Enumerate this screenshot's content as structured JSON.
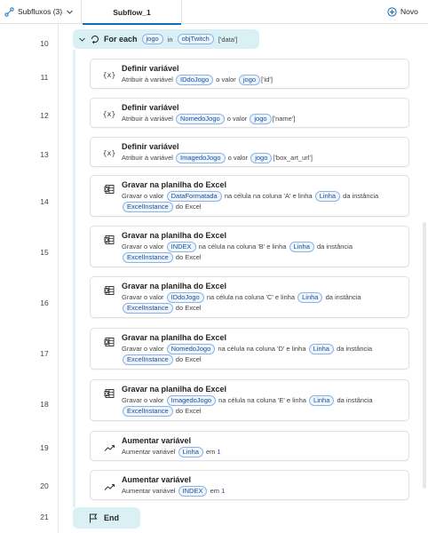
{
  "tabs": {
    "subflows_label": "Subfluxos (3)",
    "active_tab": "Subflow_1",
    "new_label": "Novo"
  },
  "line_numbers": [
    "10",
    "11",
    "12",
    "13",
    "14",
    "15",
    "16",
    "17",
    "18",
    "19",
    "20",
    "21"
  ],
  "foreach": {
    "keyword": "For each",
    "var": "jogo",
    "in_text": "in",
    "source": "objTwitch",
    "suffix": "['data']"
  },
  "actions": [
    {
      "icon": "set-variable-icon",
      "title": "Definir variável",
      "p1": "Atribuir à variável",
      "t1": "IDdoJogo",
      "p2": "o valor",
      "t2": "jogo",
      "p3": "['id']"
    },
    {
      "icon": "set-variable-icon",
      "title": "Definir variável",
      "p1": "Atribuir à variável",
      "t1": "NomedoJogo",
      "p2": "o valor",
      "t2": "jogo",
      "p3": "['name']"
    },
    {
      "icon": "set-variable-icon",
      "title": "Definir variável",
      "p1": "Atribuir à variável",
      "t1": "ImagedoJogo",
      "p2": "o valor",
      "t2": "jogo",
      "p3": "['box_art_url']"
    },
    {
      "icon": "excel-write-icon",
      "title": "Gravar na planilha do Excel",
      "p1": "Gravar o valor",
      "t1": "DataFormatada",
      "p2": "na célula na coluna 'A' e linha",
      "t2": "Linha",
      "p3": "da instância",
      "t3": "ExcelInstance",
      "p4": "do Excel"
    },
    {
      "icon": "excel-write-icon",
      "title": "Gravar na planilha do Excel",
      "p1": "Gravar o valor",
      "t1": "INDEX",
      "p2": "na célula na coluna 'B' e linha",
      "t2": "Linha",
      "p3": "da instância",
      "t3": "ExcelInstance",
      "p4": "do Excel"
    },
    {
      "icon": "excel-write-icon",
      "title": "Gravar na planilha do Excel",
      "p1": "Gravar o valor",
      "t1": "IDdoJogo",
      "p2": "na célula na coluna 'C' e linha",
      "t2": "Linha",
      "p3": "da instância",
      "t3": "ExcelInstance",
      "p4": "do Excel"
    },
    {
      "icon": "excel-write-icon",
      "title": "Gravar na planilha do Excel",
      "p1": "Gravar o valor",
      "t1": "NomedoJogo",
      "p2": "na célula na coluna 'D' e linha",
      "t2": "Linha",
      "p3": "da instância",
      "t3": "ExcelInstance",
      "p4": "do Excel"
    },
    {
      "icon": "excel-write-icon",
      "title": "Gravar na planilha do Excel",
      "p1": "Gravar o valor",
      "t1": "ImagedoJogo",
      "p2": "na célula na coluna 'E' e linha",
      "t2": "Linha",
      "p3": "da instância",
      "t3": "ExcelInstance",
      "p4": "do Excel"
    },
    {
      "icon": "increase-variable-icon",
      "title": "Aumentar variável",
      "p1": "Aumentar variável",
      "t1": "Linha",
      "p2": "em",
      "v2": "1"
    },
    {
      "icon": "increase-variable-icon",
      "title": "Aumentar variável",
      "p1": "Aumentar variável",
      "t1": "INDEX",
      "p2": "em",
      "v2": "1"
    }
  ],
  "end": {
    "keyword": "End"
  }
}
